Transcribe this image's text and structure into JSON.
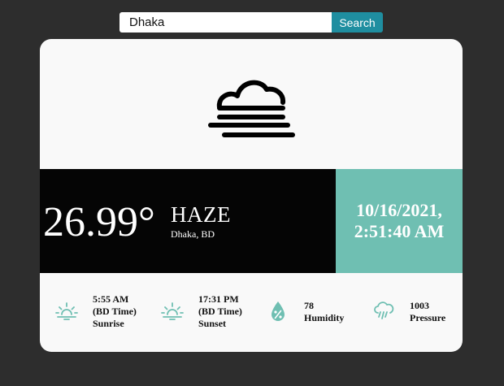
{
  "search": {
    "value": "Dhaka",
    "button_label": "Search"
  },
  "weather": {
    "icon": "haze-icon",
    "temperature": "26.99°",
    "condition": "HAZE",
    "location": "Dhaka, BD",
    "date": "10/16/2021,",
    "time": "2:51:40 AM"
  },
  "stats": {
    "sunrise": {
      "icon": "sunrise-icon",
      "value": "5:55 AM",
      "note": "(BD Time)",
      "label": "Sunrise"
    },
    "sunset": {
      "icon": "sunset-icon",
      "value": "17:31 PM",
      "note": "(BD Time)",
      "label": "Sunset"
    },
    "humidity": {
      "icon": "humidity-drop-icon",
      "value": "78",
      "label": "Humidity"
    },
    "pressure": {
      "icon": "rain-cloud-icon",
      "value": "1003",
      "label": "Pressure"
    }
  },
  "colors": {
    "page_background": "#2d2d2d",
    "card_background": "#f9f9f9",
    "search_button": "#1f8ea0",
    "temp_panel": "#050505",
    "accent_teal": "#6fbfb2"
  }
}
